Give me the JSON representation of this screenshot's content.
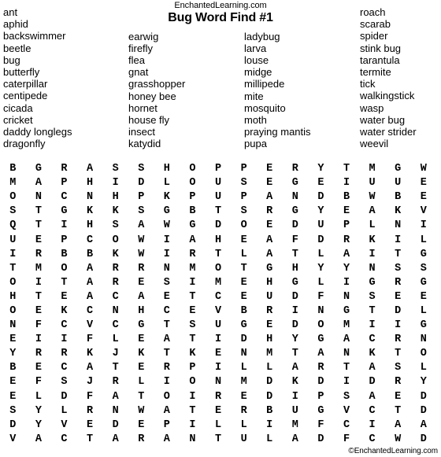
{
  "header": {
    "site": "EnchantedLearning.com",
    "title": "Bug Word Find #1"
  },
  "footer": {
    "copyright": "©EnchantedLearning.com"
  },
  "wordlist": {
    "columns": [
      {
        "words": [
          "ant",
          "aphid",
          "backswimmer",
          "beetle",
          "bug",
          "butterfly",
          "caterpillar",
          "centipede",
          "cicada",
          "cricket",
          "daddy longlegs",
          "dragonfly"
        ]
      },
      {
        "words": [
          "earwig",
          "firefly",
          "flea",
          "gnat",
          "grasshopper",
          "honey bee",
          "hornet",
          "house fly",
          "insect",
          "katydid"
        ]
      },
      {
        "words": [
          "ladybug",
          "larva",
          "louse",
          "midge",
          "millipede",
          "mite",
          "mosquito",
          "moth",
          "praying mantis",
          "pupa"
        ]
      },
      {
        "words": [
          "roach",
          "scarab",
          "spider",
          "stink bug",
          "tarantula",
          "termite",
          "tick",
          "walkingstick",
          "wasp",
          "water bug",
          "water strider",
          "weevil"
        ]
      }
    ]
  },
  "grid": {
    "rows": 20,
    "cols": 17,
    "letters": [
      [
        "B",
        "G",
        "R",
        "A",
        "S",
        "S",
        "H",
        "O",
        "P",
        "P",
        "E",
        "R",
        "Y",
        "T",
        "M",
        "G",
        "W"
      ],
      [
        "M",
        "A",
        "P",
        "H",
        "I",
        "D",
        "L",
        "O",
        "U",
        "S",
        "E",
        "G",
        "E",
        "I",
        "U",
        "U",
        "E"
      ],
      [
        "O",
        "N",
        "C",
        "N",
        "H",
        "P",
        "K",
        "P",
        "U",
        "P",
        "A",
        "N",
        "D",
        "B",
        "W",
        "B",
        "E"
      ],
      [
        "S",
        "T",
        "G",
        "K",
        "K",
        "S",
        "G",
        "B",
        "T",
        "S",
        "R",
        "G",
        "Y",
        "E",
        "A",
        "K",
        "V"
      ],
      [
        "Q",
        "T",
        "I",
        "H",
        "S",
        "A",
        "W",
        "G",
        "D",
        "O",
        "E",
        "D",
        "U",
        "P",
        "L",
        "N",
        "I"
      ],
      [
        "U",
        "E",
        "P",
        "C",
        "O",
        "W",
        "I",
        "A",
        "H",
        "E",
        "A",
        "F",
        "D",
        "R",
        "K",
        "I",
        "L"
      ],
      [
        "I",
        "R",
        "B",
        "B",
        "K",
        "W",
        "I",
        "R",
        "T",
        "L",
        "A",
        "T",
        "L",
        "A",
        "I",
        "T",
        "G"
      ],
      [
        "T",
        "M",
        "O",
        "A",
        "R",
        "R",
        "N",
        "M",
        "O",
        "T",
        "G",
        "H",
        "Y",
        "Y",
        "N",
        "S",
        "S"
      ],
      [
        "O",
        "I",
        "T",
        "A",
        "R",
        "E",
        "S",
        "I",
        "M",
        "E",
        "H",
        "G",
        "L",
        "I",
        "G",
        "R",
        "G"
      ],
      [
        "H",
        "T",
        "E",
        "A",
        "C",
        "A",
        "E",
        "T",
        "C",
        "E",
        "U",
        "D",
        "F",
        "N",
        "S",
        "E",
        "E"
      ],
      [
        "O",
        "E",
        "K",
        "C",
        "N",
        "H",
        "C",
        "E",
        "V",
        "B",
        "R",
        "I",
        "N",
        "G",
        "T",
        "D",
        "L"
      ],
      [
        "N",
        "F",
        "C",
        "V",
        "C",
        "G",
        "T",
        "S",
        "U",
        "G",
        "E",
        "D",
        "O",
        "M",
        "I",
        "I",
        "G"
      ],
      [
        "E",
        "I",
        "I",
        "F",
        "L",
        "E",
        "A",
        "T",
        "I",
        "D",
        "H",
        "Y",
        "G",
        "A",
        "C",
        "R",
        "N"
      ],
      [
        "Y",
        "R",
        "R",
        "K",
        "J",
        "K",
        "T",
        "K",
        "E",
        "N",
        "M",
        "T",
        "A",
        "N",
        "K",
        "T",
        "O"
      ],
      [
        "B",
        "E",
        "C",
        "A",
        "T",
        "E",
        "R",
        "P",
        "I",
        "L",
        "L",
        "A",
        "R",
        "T",
        "A",
        "S",
        "L"
      ],
      [
        "E",
        "F",
        "S",
        "J",
        "R",
        "L",
        "I",
        "O",
        "N",
        "M",
        "D",
        "K",
        "D",
        "I",
        "D",
        "R",
        "Y"
      ],
      [
        "E",
        "L",
        "D",
        "F",
        "A",
        "T",
        "O",
        "I",
        "R",
        "E",
        "D",
        "I",
        "P",
        "S",
        "A",
        "E",
        "D"
      ],
      [
        "S",
        "Y",
        "L",
        "R",
        "N",
        "W",
        "A",
        "T",
        "E",
        "R",
        "B",
        "U",
        "G",
        "V",
        "C",
        "T",
        "D"
      ],
      [
        "D",
        "Y",
        "V",
        "E",
        "D",
        "E",
        "P",
        "I",
        "L",
        "L",
        "I",
        "M",
        "F",
        "C",
        "I",
        "A",
        "A"
      ],
      [
        "V",
        "A",
        "C",
        "T",
        "A",
        "R",
        "A",
        "N",
        "T",
        "U",
        "L",
        "A",
        "D",
        "F",
        "C",
        "W",
        "D"
      ]
    ]
  }
}
